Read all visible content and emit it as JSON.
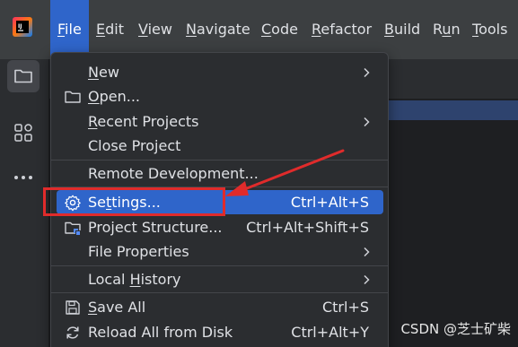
{
  "menubar": {
    "items": [
      {
        "pre": "",
        "mnem": "F",
        "post": "ile"
      },
      {
        "pre": "",
        "mnem": "E",
        "post": "dit"
      },
      {
        "pre": "",
        "mnem": "V",
        "post": "iew"
      },
      {
        "pre": "",
        "mnem": "N",
        "post": "avigate"
      },
      {
        "pre": "",
        "mnem": "C",
        "post": "ode"
      },
      {
        "pre": "",
        "mnem": "R",
        "post": "efactor"
      },
      {
        "pre": "",
        "mnem": "B",
        "post": "uild"
      },
      {
        "pre": "R",
        "mnem": "u",
        "post": "n"
      },
      {
        "pre": "",
        "mnem": "T",
        "post": "ools"
      }
    ]
  },
  "app": {
    "logo": "intellij-idea-logo"
  },
  "toolstrip": {
    "icons": [
      "project-folder-icon",
      "structure-icon",
      "more-icon"
    ]
  },
  "file_menu": {
    "items": [
      {
        "pre": "",
        "mnem": "N",
        "post": "ew",
        "icon": "",
        "shortcut": "",
        "submenu": true
      },
      {
        "pre": "",
        "mnem": "O",
        "post": "pen...",
        "icon": "folder-icon",
        "shortcut": "",
        "submenu": false
      },
      {
        "pre": "",
        "mnem": "R",
        "post": "ecent Projects",
        "icon": "",
        "shortcut": "",
        "submenu": true
      },
      {
        "pre": "Close Project",
        "mnem": "",
        "post": "",
        "icon": "",
        "shortcut": "",
        "submenu": false
      },
      {
        "pre": "Remote Development...",
        "mnem": "",
        "post": "",
        "icon": "",
        "shortcut": "",
        "submenu": false
      },
      {
        "pre": "Se",
        "mnem": "t",
        "post": "tings...",
        "icon": "gear-icon",
        "shortcut": "Ctrl+Alt+S",
        "submenu": false
      },
      {
        "pre": "Project Structure...",
        "mnem": "",
        "post": "",
        "icon": "project-structure-icon",
        "shortcut": "Ctrl+Alt+Shift+S",
        "submenu": false
      },
      {
        "pre": "File Properties",
        "mnem": "",
        "post": "",
        "icon": "",
        "shortcut": "",
        "submenu": true
      },
      {
        "pre": "Local ",
        "mnem": "H",
        "post": "istory",
        "icon": "",
        "shortcut": "",
        "submenu": true
      },
      {
        "pre": "",
        "mnem": "S",
        "post": "ave All",
        "icon": "save-icon",
        "shortcut": "Ctrl+S",
        "submenu": false
      },
      {
        "pre": "Reload All from Disk",
        "mnem": "",
        "post": "",
        "icon": "reload-icon",
        "shortcut": "Ctrl+Alt+Y",
        "submenu": false
      }
    ],
    "highlighted": "Settings..."
  },
  "colors": {
    "menubar_bg": "#3c3f41",
    "accent": "#2f65ca",
    "popup_bg": "#2b2d30",
    "text": "#dfe1e5",
    "annotation_red": "#e02b2b"
  },
  "watermark": "CSDN @芝士矿柴"
}
